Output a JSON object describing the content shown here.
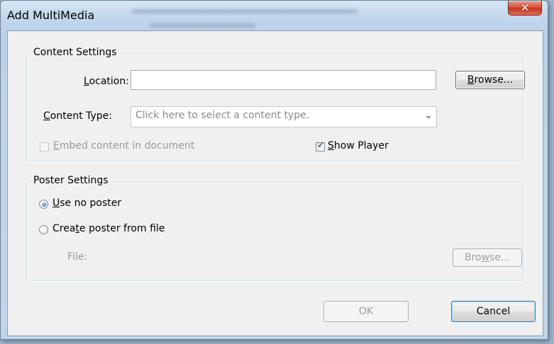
{
  "window": {
    "title": "Add MultiMedia",
    "close_glyph": "✕"
  },
  "content_settings": {
    "legend": "Content Settings",
    "location_label": "Location:",
    "location_value": "",
    "browse_button": "Browse...",
    "content_type_label": "Content Type:",
    "content_type_placeholder": "Click here to select a content type.",
    "embed_checkbox_label": "Embed content in document",
    "embed_checked": false,
    "show_player_label": "Show Player",
    "show_player_checked": true
  },
  "poster_settings": {
    "legend": "Poster Settings",
    "use_no_poster_label": "Use no poster",
    "create_poster_label": "Create poster from file",
    "selected_option": "use_no_poster",
    "file_label": "File:",
    "file_browse_button": "Browse..."
  },
  "footer": {
    "ok_button": "OK",
    "cancel_button": "Cancel"
  },
  "icons": {
    "close": "close-icon",
    "checkmark": "checkmark-icon",
    "dropdown_arrow": "chevron-down-icon",
    "radio_dot": "radio-dot-icon"
  }
}
